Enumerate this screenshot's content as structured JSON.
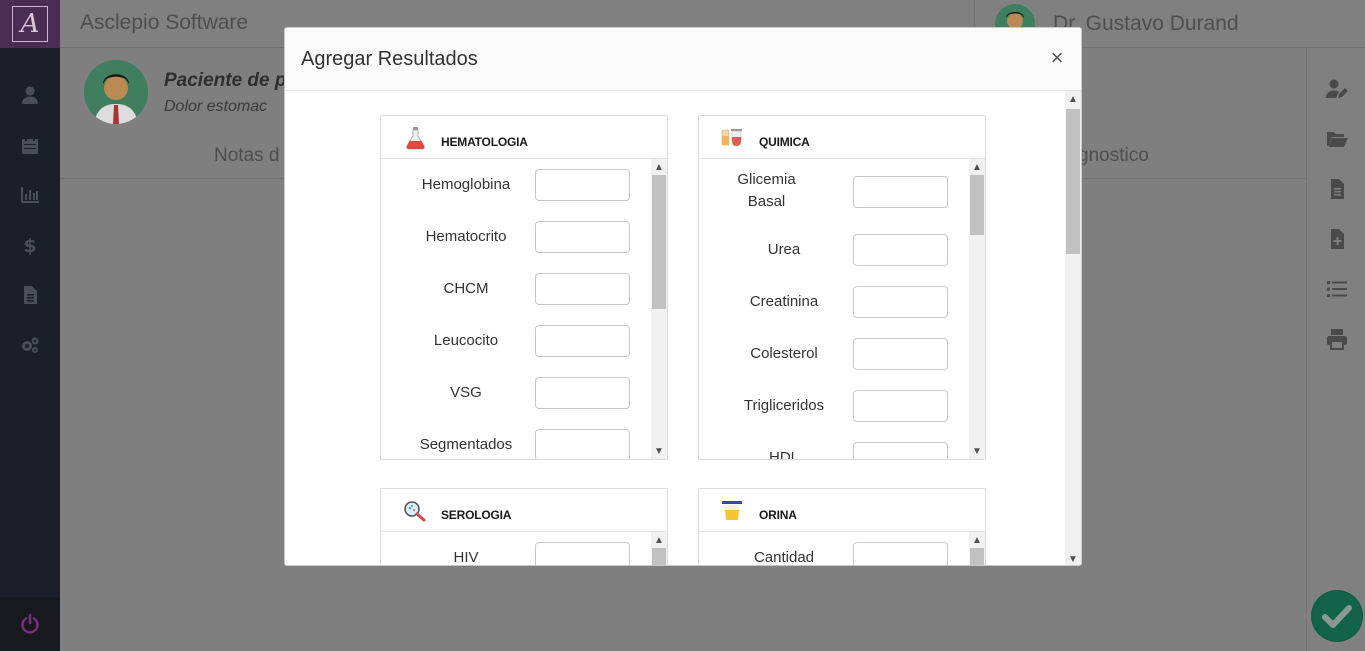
{
  "app": {
    "title": "Asclepio Software",
    "logo_letter": "A"
  },
  "user": {
    "name": "Dr. Gustavo Durand"
  },
  "patient": {
    "name": "Paciente de p",
    "reason": "Dolor estomac"
  },
  "tabs": {
    "left_label": "Notas d",
    "right_label": "gnostico"
  },
  "sidebar": {
    "icons": [
      "user-icon",
      "calendar-icon",
      "chart-icon",
      "dollar-icon",
      "file-icon",
      "gears-icon"
    ],
    "power_icon": "power-icon"
  },
  "rightbar": {
    "icons": [
      "user-edit-icon",
      "folder-open-icon",
      "document-icon",
      "file-plus-icon",
      "list-icon",
      "print-icon"
    ]
  },
  "modal": {
    "title": "Agregar Resultados",
    "close_label": "×",
    "sections": [
      {
        "title": "HEMATOLOGIA",
        "icon": "flask-icon",
        "fields": [
          "Hemoglobina",
          "Hematocrito",
          "CHCM",
          "Leucocito",
          "VSG",
          "Segmentados"
        ]
      },
      {
        "title": "QUIMICA",
        "icon": "tubes-icon",
        "fields": [
          "Glicemia Basal",
          "Urea",
          "Creatinina",
          "Colesterol",
          "Trigliceridos",
          "HDL"
        ]
      },
      {
        "title": "SEROLOGIA",
        "icon": "magnifier-icon",
        "fields": [
          "HIV"
        ]
      },
      {
        "title": "ORINA",
        "icon": "urine-cup-icon",
        "fields": [
          "Cantidad"
        ]
      }
    ]
  },
  "colors": {
    "sidebar": "#1c1f2a",
    "logo_bg": "#4a2d52",
    "power": "#7a2f7a",
    "fab": "#0f5a44"
  }
}
